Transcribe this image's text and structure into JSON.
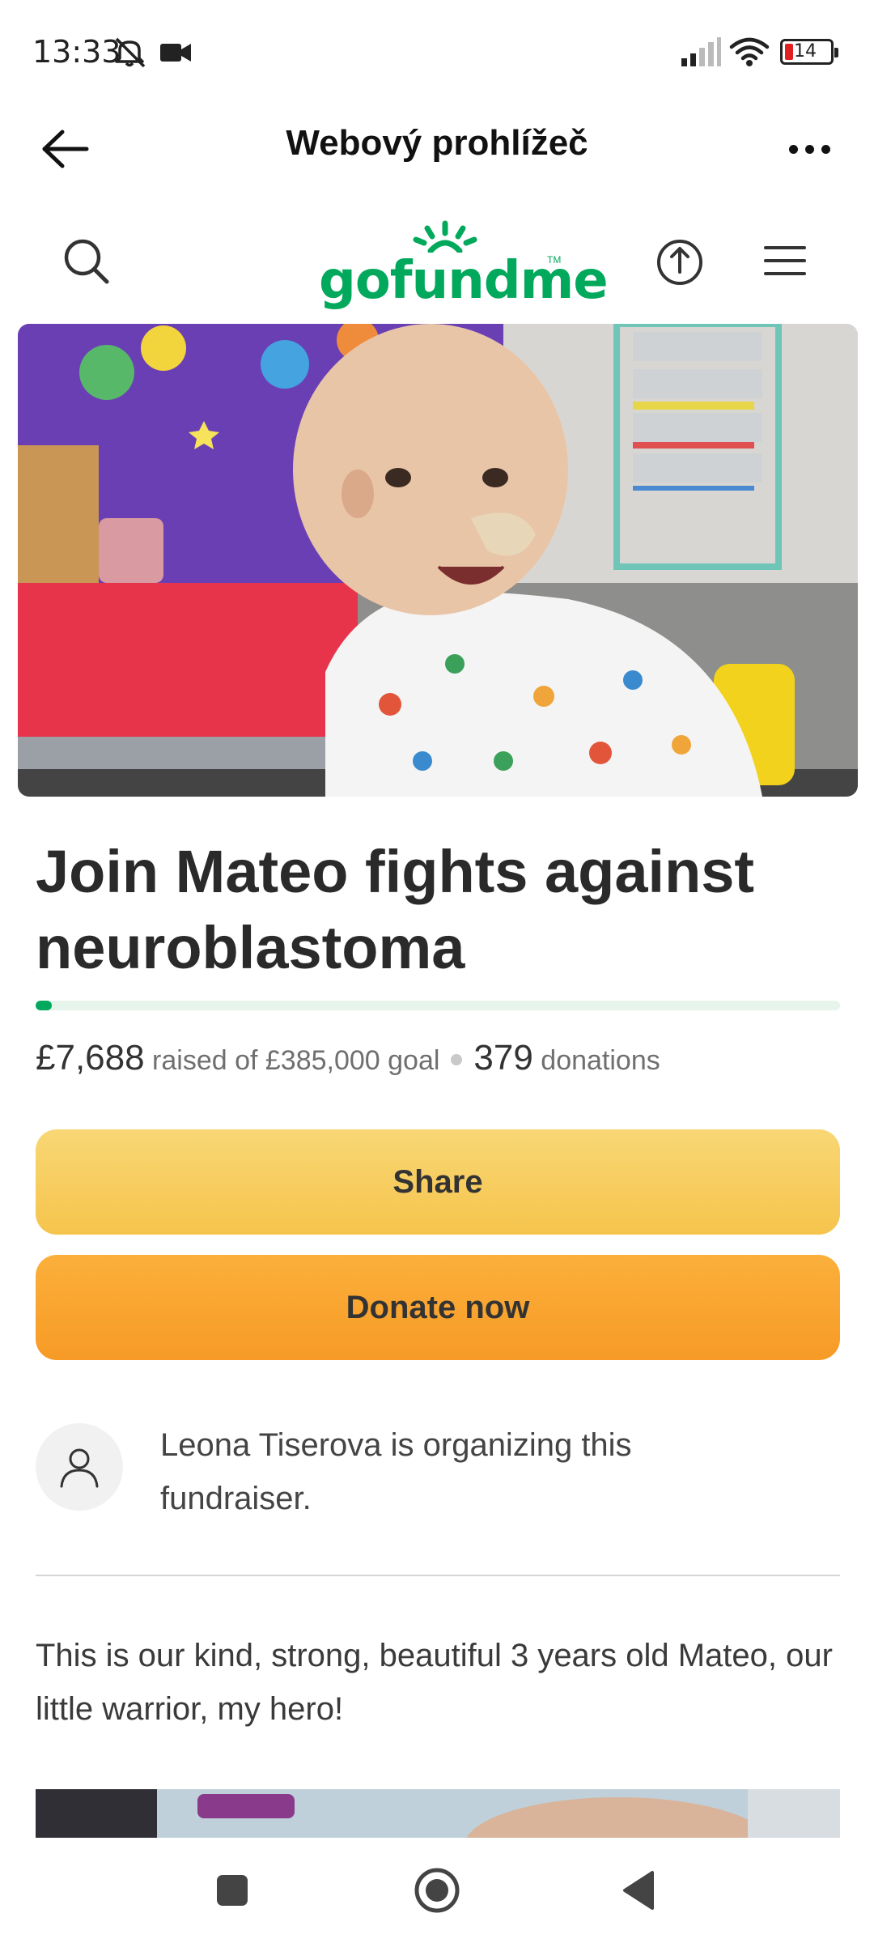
{
  "status_bar": {
    "time": "13:33",
    "battery_level": "14",
    "icons": [
      "mute-icon",
      "video-camera-icon",
      "signal-icon",
      "wifi-icon",
      "battery-icon"
    ]
  },
  "app_bar": {
    "title": "Webový prohlížeč",
    "back_icon": "arrow-left-icon",
    "more_icon": "more-dots-icon"
  },
  "site_header": {
    "logo_text": "gofundme",
    "logo_tm": "TM",
    "icons": [
      "search-icon",
      "share-upload-icon",
      "menu-icon"
    ],
    "brand_color": "#02a95c"
  },
  "campaign": {
    "title": "Join Mateo fights against neuroblastoma",
    "raised": "£7,688",
    "raised_label": "raised of £385,000 goal",
    "donations_count": "379",
    "donations_label": "donations",
    "progress_fraction": 0.02,
    "share_button": "Share",
    "donate_button": "Donate now"
  },
  "organizer": {
    "text": "Leona Tiserova is organizing this fundraiser."
  },
  "story": {
    "text": "This is our kind, strong, beautiful 3 years old Mateo, our little warrior, my hero!"
  },
  "nav_bar": {
    "icons": [
      "recents-square-icon",
      "home-circle-icon",
      "back-triangle-icon"
    ]
  }
}
